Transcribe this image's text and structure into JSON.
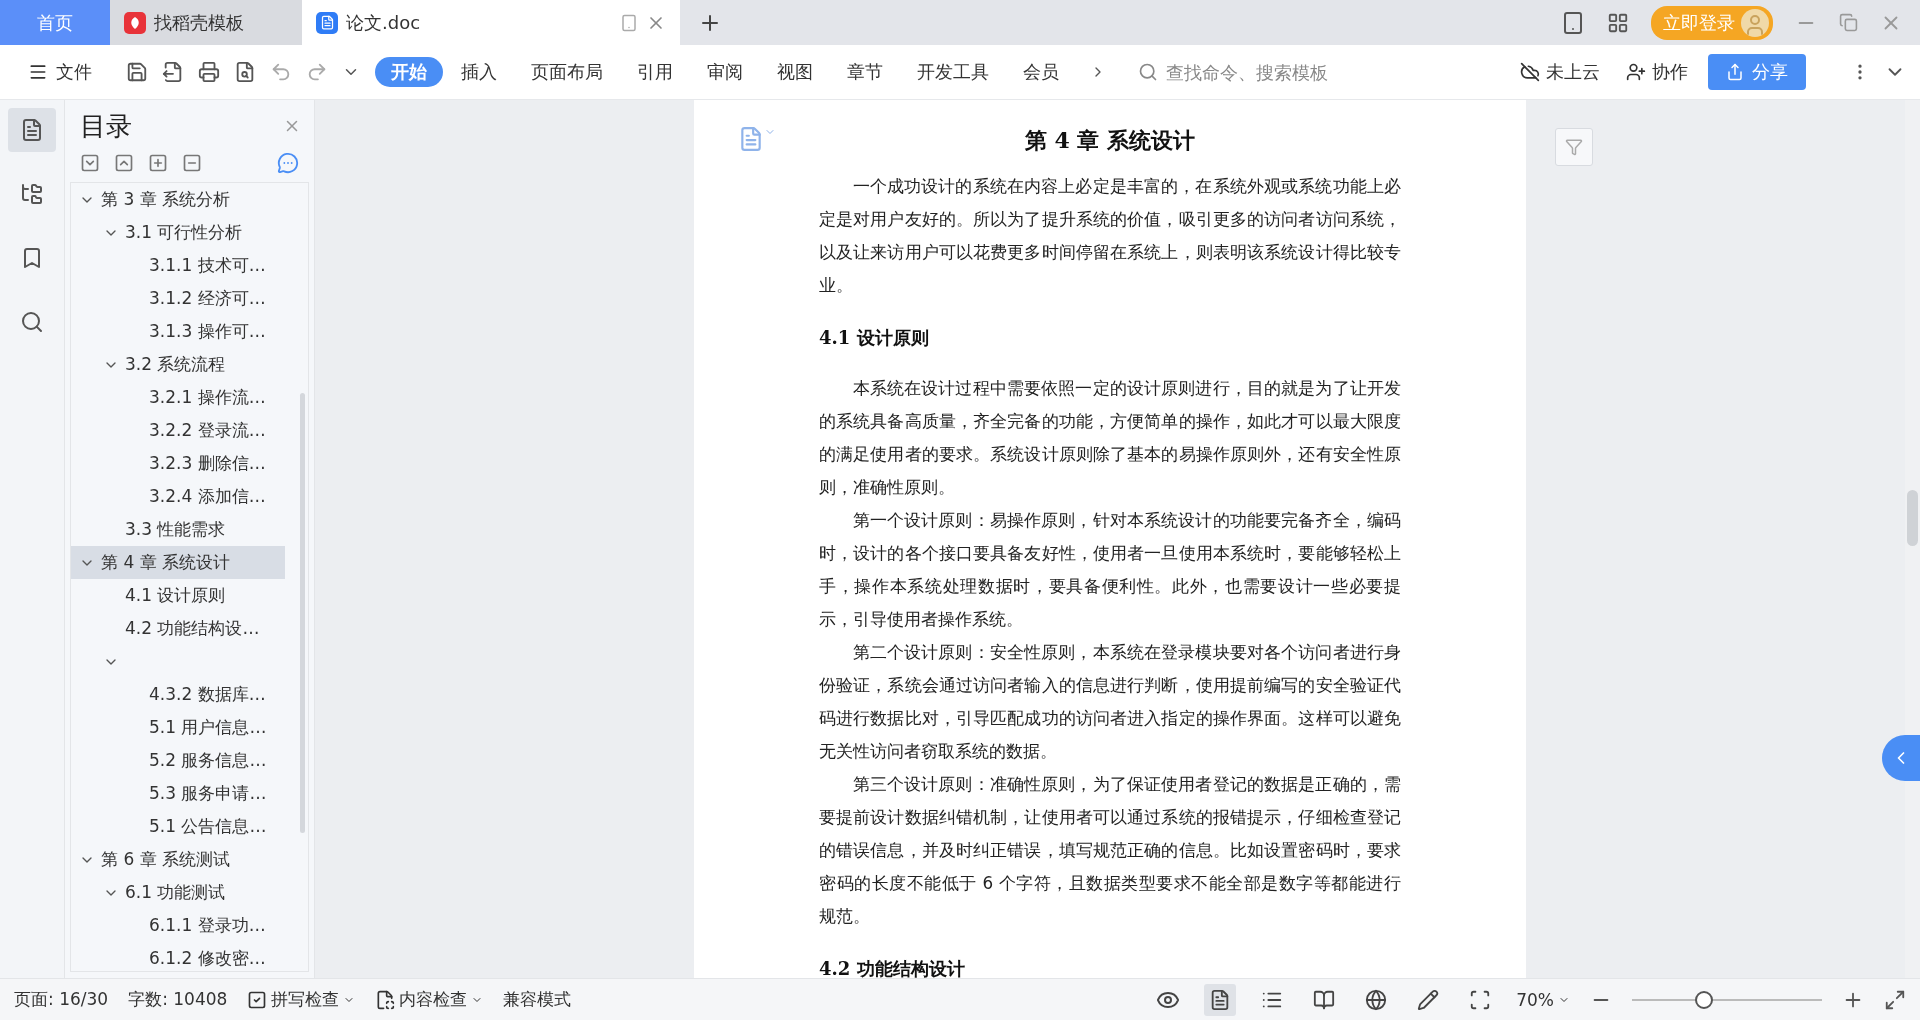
{
  "tabs": [
    {
      "label": "首页",
      "kind": "home",
      "selected": false
    },
    {
      "label": "找稻壳模板",
      "kind": "docer",
      "selected": false
    },
    {
      "label": "论文.doc",
      "kind": "doc",
      "selected": true
    }
  ],
  "login_button": "立即登录",
  "toolbar": {
    "file_menu": "文件",
    "ribbon_tabs": [
      {
        "label": "开始",
        "selected": true
      },
      {
        "label": "插入",
        "selected": false
      },
      {
        "label": "页面布局",
        "selected": false
      },
      {
        "label": "引用",
        "selected": false
      },
      {
        "label": "审阅",
        "selected": false
      },
      {
        "label": "视图",
        "selected": false
      },
      {
        "label": "章节",
        "selected": false
      },
      {
        "label": "开发工具",
        "selected": false
      },
      {
        "label": "会员",
        "selected": false
      }
    ],
    "search": {
      "placeholder": "查找命令、搜索模板"
    },
    "cloud_status": "未上云",
    "collaborate": "协作",
    "share": "分享"
  },
  "sidebar": {
    "title": "目录",
    "toc": [
      {
        "label": "第 3 章  系统分析",
        "expanded": true,
        "selected": false,
        "children": [
          {
            "label": "3.1  可行性分析",
            "expanded": true,
            "selected": false,
            "children": [
              {
                "label": "3.1.1  技术可…",
                "selected": false
              },
              {
                "label": "3.1.2  经济可…",
                "selected": false
              },
              {
                "label": "3.1.3  操作可…",
                "selected": false
              }
            ]
          },
          {
            "label": "3.2  系统流程",
            "expanded": true,
            "selected": false,
            "children": [
              {
                "label": "3.2.1  操作流…",
                "selected": false
              },
              {
                "label": "3.2.2  登录流…",
                "selected": false
              },
              {
                "label": "3.2.3  删除信…",
                "selected": false
              },
              {
                "label": "3.2.4  添加信…",
                "selected": false
              }
            ]
          },
          {
            "label": "3.3  性能需求",
            "selected": false
          }
        ]
      },
      {
        "label": "第 4 章  系统设计",
        "expanded": true,
        "selected": true,
        "children": [
          {
            "label": "4.1  设计原则",
            "selected": false
          },
          {
            "label": "4.2  功能结构设…",
            "selected": false
          },
          {
            "expanded": true,
            "selected": false,
            "children": [
              {
                "label": "4.3.2  数据库…",
                "selected": false
              },
              {
                "label": "5.1 用户信息…",
                "selected": false
              },
              {
                "label": "5.2  服务信息…",
                "selected": false
              },
              {
                "label": "5.3 服务申请…",
                "selected": false
              },
              {
                "label": "5.1 公告信息…",
                "selected": false
              }
            ]
          }
        ]
      },
      {
        "label": "第 6 章  系统测试",
        "expanded": true,
        "selected": false,
        "children": [
          {
            "label": "6.1  功能测试",
            "expanded": true,
            "selected": false,
            "children": [
              {
                "label": "6.1.1  登录功…",
                "selected": false
              },
              {
                "label": "6.1.2  修改密…",
                "selected": false
              }
            ]
          }
        ]
      }
    ]
  },
  "document": {
    "blocks": [
      {
        "kind": "title",
        "text": "第 4 章  系统设计"
      },
      {
        "kind": "paragraph",
        "text": "一个成功设计的系统在内容上必定是丰富的，在系统外观或系统功能上必定是对用户友好的。所以为了提升系统的价值，吸引更多的访问者访问系统，以及让来访用户可以花费更多时间停留在系统上，则表明该系统设计得比较专业。"
      },
      {
        "kind": "heading",
        "text": "4.1  设计原则"
      },
      {
        "kind": "paragraph",
        "text": "本系统在设计过程中需要依照一定的设计原则进行，目的就是为了让开发的系统具备高质量，齐全完备的功能，方便简单的操作，如此才可以最大限度的满足使用者的要求。系统设计原则除了基本的易操作原则外，还有安全性原则，准确性原则。"
      },
      {
        "kind": "paragraph",
        "text": "第一个设计原则：易操作原则，针对本系统设计的功能要完备齐全，编码时，设计的各个接口要具备友好性，使用者一旦使用本系统时，要能够轻松上手，操作本系统处理数据时，要具备便利性。此外，也需要设计一些必要提示，引导使用者操作系统。"
      },
      {
        "kind": "paragraph",
        "text": "第二个设计原则：安全性原则，本系统在登录模块要对各个访问者进行身份验证，系统会通过访问者输入的信息进行判断，使用提前编写的安全验证代码进行数据比对，引导匹配成功的访问者进入指定的操作界面。这样可以避免无关性访问者窃取系统的数据。"
      },
      {
        "kind": "paragraph",
        "text": "第三个设计原则：准确性原则，为了保证使用者登记的数据是正确的，需要提前设计数据纠错机制，让使用者可以通过系统的报错提示，仔细检查登记的错误信息，并及时纠正错误，填写规范正确的信息。比如设置密码时，要求密码的长度不能低于 6 个字符，且数据类型要求不能全部是数字等都能进行规范。"
      },
      {
        "kind": "heading",
        "text": "4.2  功能结构设计"
      }
    ]
  },
  "status_bar": {
    "page": "页面: 16/30",
    "words": "字数: 10408",
    "spell_check": "拼写检查",
    "content_check": "内容检查",
    "mode": "兼容模式",
    "zoom": "70%",
    "zoom_slider": {
      "level": 0.38
    }
  }
}
